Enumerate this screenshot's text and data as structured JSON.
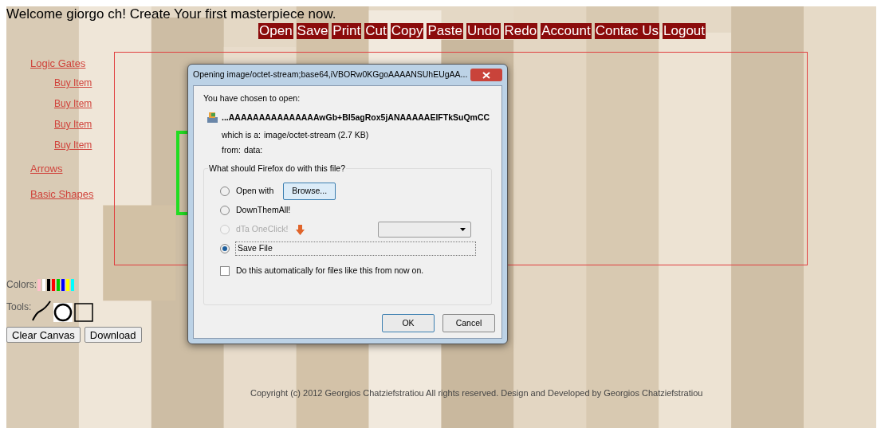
{
  "welcome": "Welcome giorgo ch! Create Your first masterpiece now.",
  "menu": [
    "Open",
    "Save",
    "Print",
    "Cut",
    "Copy",
    "Paste",
    "Undo",
    "Redo",
    "Account",
    "Contac Us",
    "Logout"
  ],
  "sidebar": [
    {
      "label": "Logic Gates",
      "children": [
        {
          "label": "Buy Item"
        },
        {
          "label": "Buy Item"
        },
        {
          "label": "Buy Item"
        },
        {
          "label": "Buy Item"
        }
      ]
    },
    {
      "label": "Arrows"
    },
    {
      "label": "Basic Shapes"
    }
  ],
  "colors": {
    "label": "Colors:",
    "swatches": [
      {
        "color": "#ffc0cb"
      },
      {
        "color": "#ffffff"
      },
      {
        "color": "#000000"
      },
      {
        "color": "#ff0000"
      },
      {
        "color": "#00cc00"
      },
      {
        "color": "#0000ff"
      },
      {
        "color": "#ffff00"
      },
      {
        "color": "#00ffff"
      }
    ]
  },
  "tools": {
    "label": "Tools:",
    "items": [
      {
        "kind": "line"
      },
      {
        "kind": "circle"
      },
      {
        "kind": "square"
      }
    ]
  },
  "buttons": [
    "Clear Canvas",
    "Download"
  ],
  "copyright": "Copyright (c) 2012 Georgios Chatziefstratiou All rights reserved. Design and Developed by Georgios Chatziefstratiou",
  "dialog": {
    "title": "Opening image/octet-stream;base64,iVBORw0KGgoAAAANSUhEUgAA...",
    "intro": "You have chosen to open:",
    "filename": "...AAAAAAAAAAAAAAAwGb+BI5agRox5jANAAAAAElFTkSuQmCC",
    "type_label": "which is a:",
    "type_value": "image/octet-stream (2.7 KB)",
    "from_label": "from:",
    "from_value": "data:",
    "question": "What should Firefox do with this file?",
    "options": [
      {
        "label": "Open with",
        "selected": false,
        "disabled": false,
        "kind": "browse",
        "button": "Browse..."
      },
      {
        "label": "DownThemAll!",
        "selected": false,
        "disabled": false,
        "kind": "plain"
      },
      {
        "label": "dTa OneClick!",
        "selected": false,
        "disabled": true,
        "kind": "dropdown"
      },
      {
        "label": "Save File",
        "selected": true,
        "disabled": false,
        "kind": "plain"
      }
    ],
    "auto": {
      "label": "Do this automatically for files like this from now on.",
      "checked": false
    },
    "buttons": [
      "OK",
      "Cancel"
    ]
  }
}
